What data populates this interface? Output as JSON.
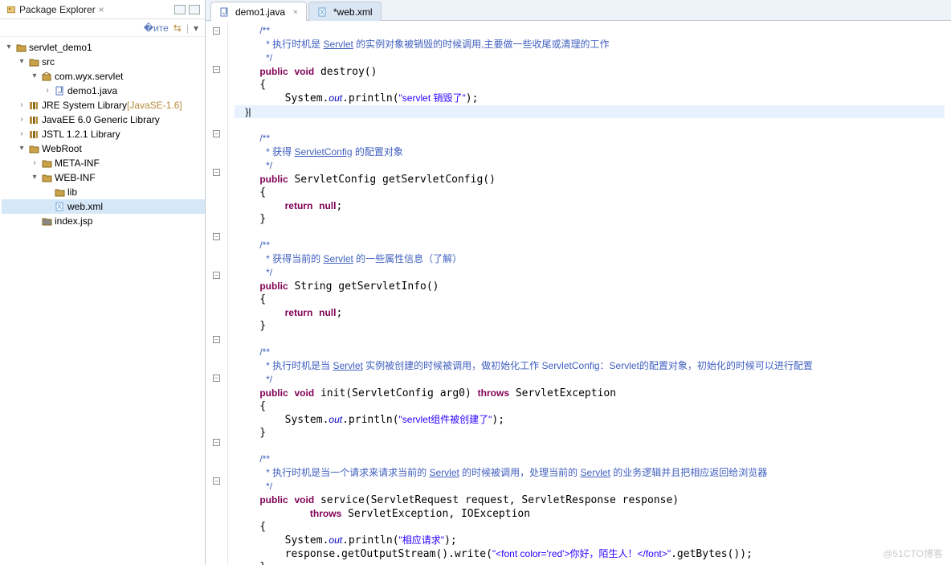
{
  "sidebar": {
    "title": "Package Explorer",
    "nodes": [
      {
        "depth": 0,
        "twisty": "▾",
        "icon": "project-icon",
        "label": "servlet_demo1"
      },
      {
        "depth": 1,
        "twisty": "▾",
        "icon": "src-folder-icon",
        "label": "src"
      },
      {
        "depth": 2,
        "twisty": "▾",
        "icon": "package-icon",
        "label": "com.wyx.servlet"
      },
      {
        "depth": 3,
        "twisty": "›",
        "icon": "java-file-icon",
        "label": "demo1.java"
      },
      {
        "depth": 1,
        "twisty": "›",
        "icon": "library-icon",
        "label": "JRE System Library",
        "decoration": "[JavaSE-1.6]"
      },
      {
        "depth": 1,
        "twisty": "›",
        "icon": "library-icon",
        "label": "JavaEE 6.0 Generic Library"
      },
      {
        "depth": 1,
        "twisty": "›",
        "icon": "library-icon",
        "label": "JSTL 1.2.1 Library"
      },
      {
        "depth": 1,
        "twisty": "▾",
        "icon": "web-folder-icon",
        "label": "WebRoot"
      },
      {
        "depth": 2,
        "twisty": "›",
        "icon": "folder-icon",
        "label": "META-INF"
      },
      {
        "depth": 2,
        "twisty": "▾",
        "icon": "web-folder-icon",
        "label": "WEB-INF"
      },
      {
        "depth": 3,
        "twisty": "",
        "icon": "folder-icon",
        "label": "lib"
      },
      {
        "depth": 3,
        "twisty": "",
        "icon": "xml-file-icon",
        "label": "web.xml",
        "selected": true
      },
      {
        "depth": 2,
        "twisty": "",
        "icon": "jsp-file-icon",
        "label": "index.jsp"
      }
    ]
  },
  "editor": {
    "tabs": [
      {
        "icon": "java-file-icon",
        "label": "demo1.java",
        "active": true
      },
      {
        "icon": "xml-file-icon",
        "label": "*web.xml",
        "active": false
      }
    ],
    "code_tokens": [
      [
        "    ",
        [
          "cm",
          "/**"
        ]
      ],
      [
        "     ",
        [
          "cm",
          "* 执行时机是 "
        ],
        [
          "cml",
          "Servlet"
        ],
        [
          "cm",
          " 的实例对象被销毁的时候调用,主要做一些收尾或清理的工作"
        ]
      ],
      [
        "     ",
        [
          "cm",
          "*/"
        ]
      ],
      [
        "    ",
        [
          "kw",
          "public"
        ],
        [
          "",
          " "
        ],
        [
          "kw",
          "void"
        ],
        [
          "",
          " destroy()"
        ]
      ],
      [
        "    {"
      ],
      [
        "        System.",
        [
          "fld",
          "out"
        ],
        [
          "",
          ".println("
        ],
        [
          "str",
          "\"servlet 销毁了\""
        ],
        [
          "",
          ");"
        ]
      ],
      [
        "hl",
        "    }|"
      ],
      [
        ""
      ],
      [
        "    ",
        [
          "cm",
          "/**"
        ]
      ],
      [
        "     ",
        [
          "cm",
          "* 获得 "
        ],
        [
          "cml",
          "ServletConfig"
        ],
        [
          "cm",
          " 的配置对象"
        ]
      ],
      [
        "     ",
        [
          "cm",
          "*/"
        ]
      ],
      [
        "    ",
        [
          "kw",
          "public"
        ],
        [
          "",
          " ServletConfig getServletConfig()"
        ]
      ],
      [
        "    {"
      ],
      [
        "        ",
        [
          "kw",
          "return"
        ],
        [
          "",
          " "
        ],
        [
          "kw",
          "null"
        ],
        [
          "",
          ";"
        ]
      ],
      [
        "    }"
      ],
      [
        ""
      ],
      [
        "    ",
        [
          "cm",
          "/**"
        ]
      ],
      [
        "     ",
        [
          "cm",
          "* 获得当前的 "
        ],
        [
          "cml",
          "Servlet"
        ],
        [
          "cm",
          " 的一些属性信息（了解）"
        ]
      ],
      [
        "     ",
        [
          "cm",
          "*/"
        ]
      ],
      [
        "    ",
        [
          "kw",
          "public"
        ],
        [
          "",
          " String getServletInfo()"
        ]
      ],
      [
        "    {"
      ],
      [
        "        ",
        [
          "kw",
          "return"
        ],
        [
          "",
          " "
        ],
        [
          "kw",
          "null"
        ],
        [
          "",
          ";"
        ]
      ],
      [
        "    }"
      ],
      [
        ""
      ],
      [
        "    ",
        [
          "cm",
          "/**"
        ]
      ],
      [
        "     ",
        [
          "cm",
          "* 执行时机是当 "
        ],
        [
          "cml",
          "Servlet"
        ],
        [
          "cm",
          " 实例被创建的时候被调用，做初始化工作 ServletConfig：Servlet的配置对象，初始化的时候可以进行配置"
        ]
      ],
      [
        "     ",
        [
          "cm",
          "*/"
        ]
      ],
      [
        "    ",
        [
          "kw",
          "public"
        ],
        [
          "",
          " "
        ],
        [
          "kw",
          "void"
        ],
        [
          "",
          " init(ServletConfig arg0) "
        ],
        [
          "kw",
          "throws"
        ],
        [
          "",
          " ServletException"
        ]
      ],
      [
        "    {"
      ],
      [
        "        System.",
        [
          "fld",
          "out"
        ],
        [
          "",
          ".println("
        ],
        [
          "str",
          "\"servlet组件被创建了\""
        ],
        [
          "",
          ");"
        ]
      ],
      [
        "    }"
      ],
      [
        ""
      ],
      [
        "    ",
        [
          "cm",
          "/**"
        ]
      ],
      [
        "     ",
        [
          "cm",
          "* 执行时机是当一个请求来请求当前的 "
        ],
        [
          "cml",
          "Servlet"
        ],
        [
          "cm",
          " 的时候被调用，处理当前的 "
        ],
        [
          "cml",
          "Servlet"
        ],
        [
          "cm",
          " 的业务逻辑并且把相应返回给浏览器"
        ]
      ],
      [
        "     ",
        [
          "cm",
          "*/"
        ]
      ],
      [
        "    ",
        [
          "kw",
          "public"
        ],
        [
          "",
          " "
        ],
        [
          "kw",
          "void"
        ],
        [
          "",
          " service(ServletRequest request, ServletResponse response)"
        ]
      ],
      [
        "            ",
        [
          "kw",
          "throws"
        ],
        [
          "",
          " ServletException, IOException"
        ]
      ],
      [
        "    {"
      ],
      [
        "        System.",
        [
          "fld",
          "out"
        ],
        [
          "",
          ".println("
        ],
        [
          "str",
          "\"相应请求\""
        ],
        [
          "",
          ");"
        ]
      ],
      [
        "        response.getOutputStream().write(",
        [
          "str",
          "\"<font color='red'>你好，陌生人！</font>\""
        ],
        [
          "",
          ".getBytes());"
        ]
      ],
      [
        "    }"
      ],
      [
        ""
      ],
      [
        "}"
      ]
    ],
    "gutter": [
      "⊖",
      "",
      "",
      "⊖",
      "",
      "",
      "",
      "",
      "⊖",
      "",
      "",
      "▵⊖",
      "",
      "",
      "",
      "",
      "⊖",
      "",
      "",
      "▵⊖",
      "",
      "",
      "",
      "",
      "⊖",
      "",
      "",
      "▵⊖",
      "",
      "",
      "",
      "",
      "⊖",
      "",
      "",
      "▵⊖",
      "",
      "",
      "",
      "",
      "",
      ""
    ]
  },
  "watermark": "@51CTO博客"
}
